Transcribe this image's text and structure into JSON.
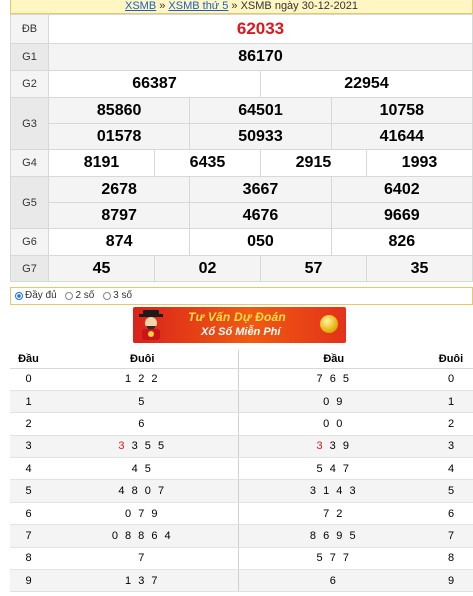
{
  "breadcrumb": {
    "link1": "XSMB",
    "sep1": " » ",
    "link2": "XSMB thứ 5",
    "sep2": " » ",
    "current": "XSMB ngày 30-12-2021"
  },
  "results": {
    "special": {
      "label": "ĐB",
      "values": [
        "62033"
      ]
    },
    "g1": {
      "label": "G1",
      "values": [
        "86170"
      ]
    },
    "g2": {
      "label": "G2",
      "values": [
        "66387",
        "22954"
      ]
    },
    "g3": {
      "label": "G3",
      "row1": [
        "85860",
        "64501",
        "10758"
      ],
      "row2": [
        "01578",
        "50933",
        "41644"
      ]
    },
    "g4": {
      "label": "G4",
      "values": [
        "8191",
        "6435",
        "2915",
        "1993"
      ]
    },
    "g5": {
      "label": "G5",
      "row1": [
        "2678",
        "3667",
        "6402"
      ],
      "row2": [
        "8797",
        "4676",
        "9669"
      ]
    },
    "g6": {
      "label": "G6",
      "values": [
        "874",
        "050",
        "826"
      ]
    },
    "g7": {
      "label": "G7",
      "values": [
        "45",
        "02",
        "57",
        "35"
      ]
    }
  },
  "display_options": {
    "selected": "Đầy đủ",
    "options": [
      "Đầy đủ",
      "2 số",
      "3 số"
    ]
  },
  "banner": {
    "line1": "Tư Vấn Dự Đoán",
    "line2": "Xổ Số Miễn Phí"
  },
  "loto": {
    "headers": [
      "Đầu",
      "Đuôi",
      "Đầu",
      "Đuôi"
    ],
    "rows": [
      {
        "dau": "0",
        "duoi_pre": "",
        "duoi_hl": "",
        "duoi": "1 2 2",
        "dau2_pre": "",
        "dau2_hl": "",
        "dau2": "7 6 5",
        "duoi2": "0"
      },
      {
        "dau": "1",
        "duoi_pre": "",
        "duoi_hl": "",
        "duoi": "5",
        "dau2_pre": "",
        "dau2_hl": "",
        "dau2": "0 9",
        "duoi2": "1"
      },
      {
        "dau": "2",
        "duoi_pre": "",
        "duoi_hl": "",
        "duoi": "6",
        "dau2_pre": "",
        "dau2_hl": "",
        "dau2": "0 0",
        "duoi2": "2"
      },
      {
        "dau": "3",
        "duoi_pre": "",
        "duoi_hl": "3",
        "duoi": " 3 5 5",
        "dau2_pre": "",
        "dau2_hl": "3",
        "dau2": " 3 9",
        "duoi2": "3"
      },
      {
        "dau": "4",
        "duoi_pre": "",
        "duoi_hl": "",
        "duoi": "4 5",
        "dau2_pre": "",
        "dau2_hl": "",
        "dau2": "5 4 7",
        "duoi2": "4"
      },
      {
        "dau": "5",
        "duoi_pre": "",
        "duoi_hl": "",
        "duoi": "4 8 0 7",
        "dau2_pre": "",
        "dau2_hl": "",
        "dau2": "3 1 4 3",
        "duoi2": "5"
      },
      {
        "dau": "6",
        "duoi_pre": "",
        "duoi_hl": "",
        "duoi": "0 7 9",
        "dau2_pre": "",
        "dau2_hl": "",
        "dau2": "7 2",
        "duoi2": "6"
      },
      {
        "dau": "7",
        "duoi_pre": "",
        "duoi_hl": "",
        "duoi": "0 8 8 6 4",
        "dau2_pre": "",
        "dau2_hl": "",
        "dau2": "8 6 9 5",
        "duoi2": "7"
      },
      {
        "dau": "8",
        "duoi_pre": "",
        "duoi_hl": "",
        "duoi": "7",
        "dau2_pre": "",
        "dau2_hl": "",
        "dau2": "5 7 7",
        "duoi2": "8"
      },
      {
        "dau": "9",
        "duoi_pre": "",
        "duoi_hl": "",
        "duoi": "1 3 7",
        "dau2_pre": "",
        "dau2_hl": "",
        "dau2": "6",
        "duoi2": "9"
      }
    ]
  },
  "colors": {
    "special_number": "#e0161d",
    "link": "#1a5fc6",
    "header_bg": "#fff6c4",
    "highlight_digit": "#e0161d"
  }
}
